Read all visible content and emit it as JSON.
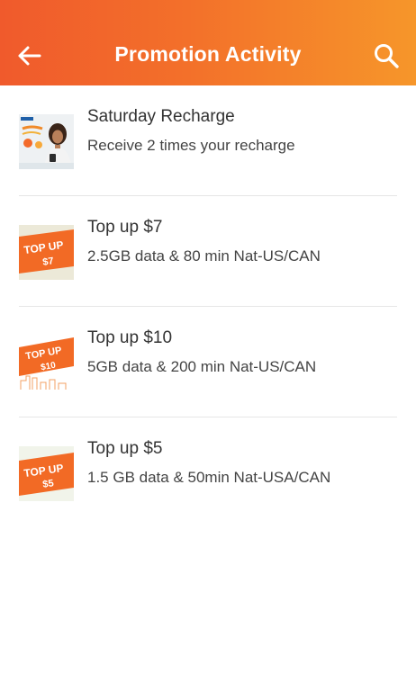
{
  "header": {
    "title": "Promotion Activity",
    "back_icon": "arrow-left-icon",
    "search_icon": "search-icon",
    "gradient": [
      "#f05a2c",
      "#f6962a"
    ]
  },
  "promotions": [
    {
      "name": "Saturday Recharge",
      "description": "Receive 2 times your recharge",
      "thumb": "saturday-recharge-thumbnail"
    },
    {
      "name": "Top up $7",
      "description": "2.5GB data & 80 min Nat-US/CAN",
      "thumb": "topup-7-thumbnail",
      "thumb_text": [
        "TOP UP",
        "$7"
      ]
    },
    {
      "name": "Top up $10",
      "description": "5GB data & 200 min Nat-US/CAN",
      "thumb": "topup-10-thumbnail",
      "thumb_text": [
        "TOP UP",
        "$10"
      ]
    },
    {
      "name": "Top up $5",
      "description": "1.5 GB data & 50min Nat-USA/CAN",
      "thumb": "topup-5-thumbnail",
      "thumb_text": [
        "TOP UP",
        "$5"
      ]
    }
  ],
  "colors": {
    "accent": "#f36f2a",
    "badge": "#f26a25",
    "text": "#333333"
  }
}
